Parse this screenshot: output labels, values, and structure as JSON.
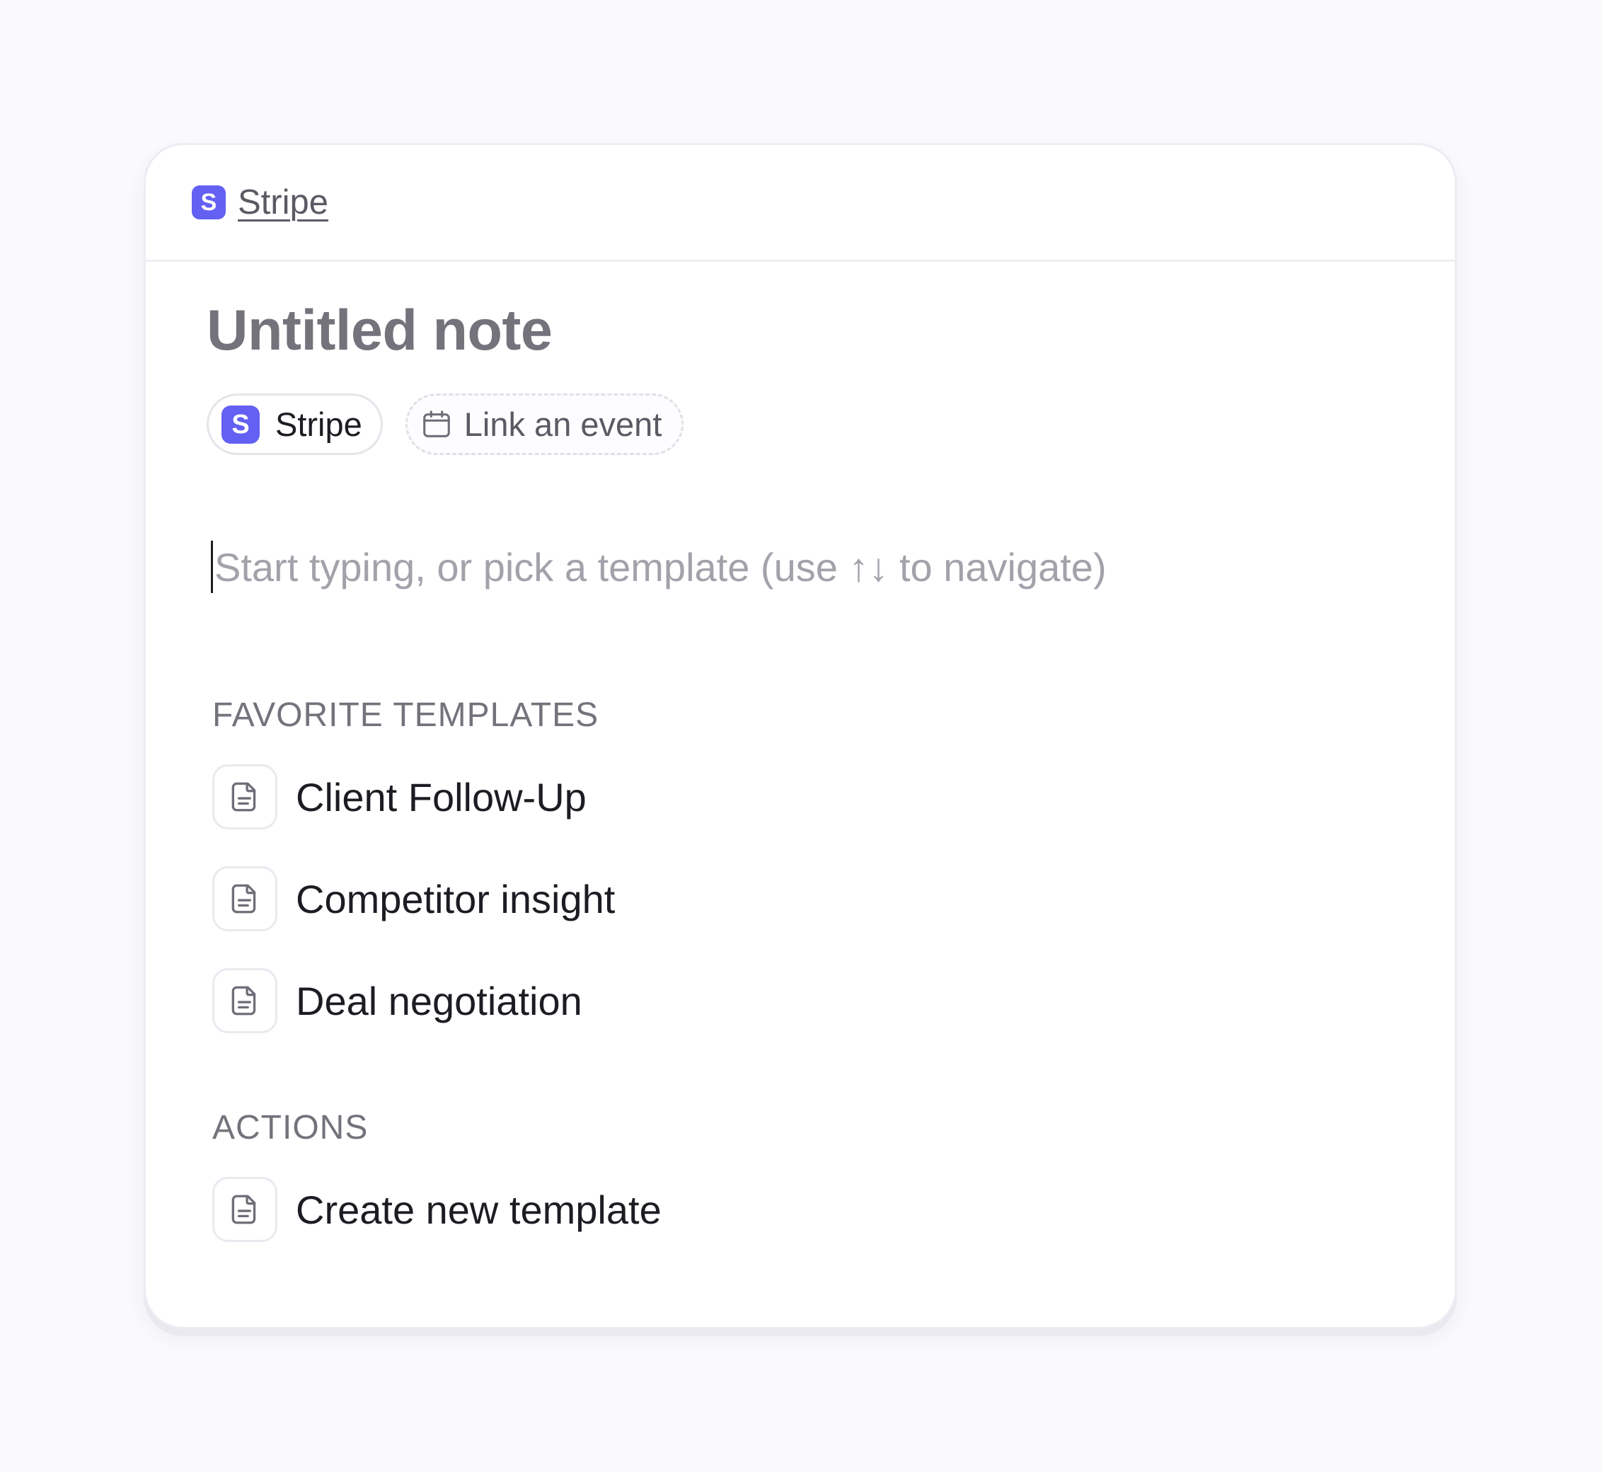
{
  "breadcrumb": {
    "logo_letter": "S",
    "label": "Stripe"
  },
  "note": {
    "title": "Untitled note"
  },
  "chips": {
    "company": {
      "logo_letter": "S",
      "label": "Stripe"
    },
    "event": {
      "icon": "calendar-icon",
      "label": "Link an event"
    }
  },
  "editor": {
    "placeholder": "Start typing, or pick a template (use ↑↓ to navigate)"
  },
  "favorite_templates": {
    "heading": "FAVORITE TEMPLATES",
    "items": [
      {
        "label": "Client Follow-Up",
        "icon": "document-icon"
      },
      {
        "label": "Competitor insight",
        "icon": "document-icon"
      },
      {
        "label": "Deal negotiation",
        "icon": "document-icon"
      }
    ]
  },
  "actions": {
    "heading": "ACTIONS",
    "items": [
      {
        "label": "Create new template",
        "icon": "document-icon"
      }
    ]
  },
  "colors": {
    "brand": "#6360f3",
    "background": "#faf9fd",
    "card": "#ffffff",
    "text_primary": "#1d1c22",
    "text_muted": "#74727b",
    "placeholder": "#a3a1aa"
  }
}
